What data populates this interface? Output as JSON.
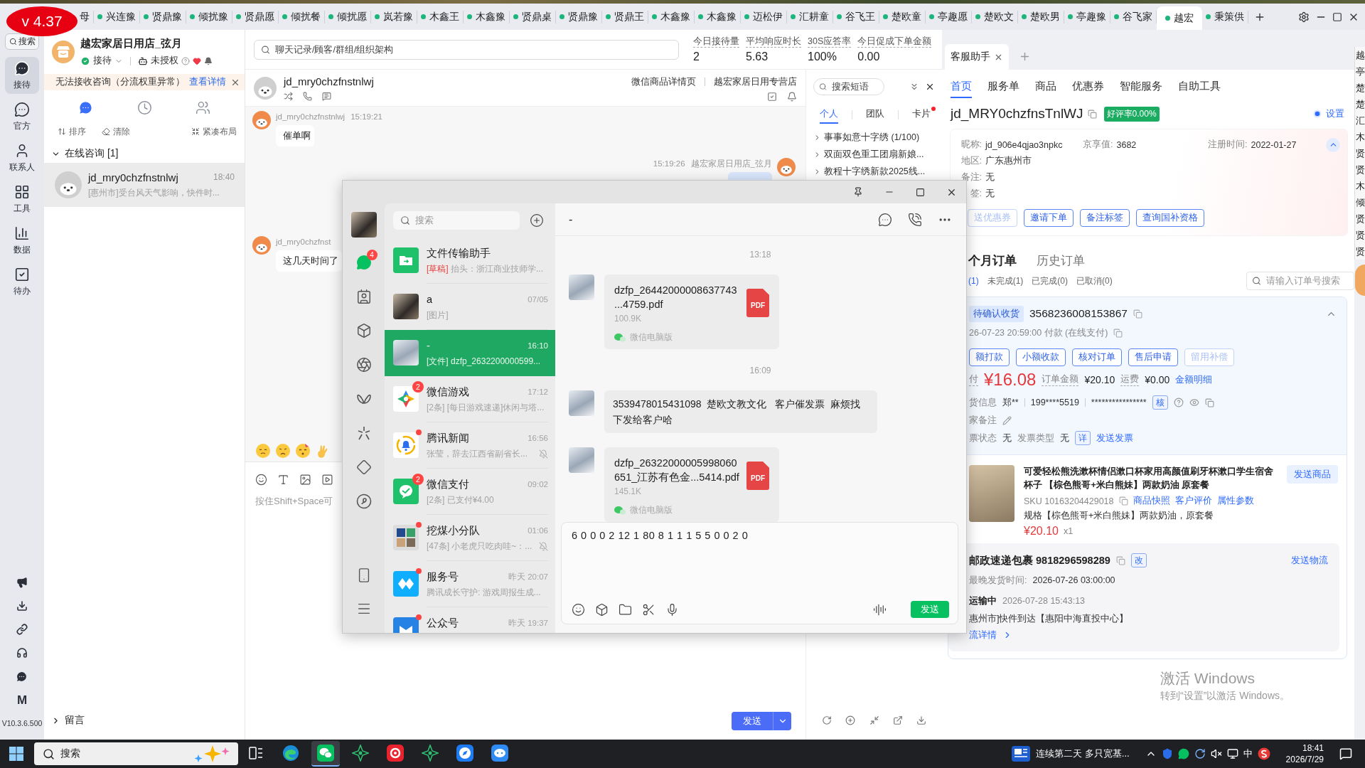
{
  "version_badge": "v 4.37",
  "shop_tabs": [
    {
      "label": "母",
      "selected": false
    },
    {
      "label": "兴连豫",
      "selected": false
    },
    {
      "label": "贤鼎豫",
      "selected": false
    },
    {
      "label": "倾扰豫",
      "selected": false
    },
    {
      "label": "贤鼎愿",
      "selected": false
    },
    {
      "label": "倾扰餐",
      "selected": false
    },
    {
      "label": "倾扰愿",
      "selected": false
    },
    {
      "label": "岚若豫",
      "selected": false
    },
    {
      "label": "木鑫王",
      "selected": false
    },
    {
      "label": "木鑫豫",
      "selected": false
    },
    {
      "label": "贤鼎桌",
      "selected": false
    },
    {
      "label": "贤鼎豫",
      "selected": false
    },
    {
      "label": "贤鼎王",
      "selected": false
    },
    {
      "label": "木鑫豫",
      "selected": false
    },
    {
      "label": "木鑫豫",
      "selected": false
    },
    {
      "label": "迈松伊",
      "selected": false
    },
    {
      "label": "汇耕童",
      "selected": false
    },
    {
      "label": "谷飞王",
      "selected": false
    },
    {
      "label": "楚欧童",
      "selected": false
    },
    {
      "label": "亭趣愿",
      "selected": false
    },
    {
      "label": "楚欧文",
      "selected": false
    },
    {
      "label": "楚欧男",
      "selected": false
    },
    {
      "label": "亭趣豫",
      "selected": false
    },
    {
      "label": "谷飞家",
      "selected": false
    },
    {
      "label": "越宏",
      "selected": true
    },
    {
      "label": "秉策供",
      "selected": false
    }
  ],
  "icon_rail": {
    "search": "搜索",
    "items": [
      {
        "label": "接待",
        "selected": true
      },
      {
        "label": "官方",
        "selected": false
      },
      {
        "label": "联系人",
        "selected": false
      },
      {
        "label": "工具",
        "selected": false
      },
      {
        "label": "数据",
        "selected": false
      },
      {
        "label": "待办",
        "selected": false
      }
    ],
    "logo_letter": "M",
    "version": "V10.3.6.500"
  },
  "conversations": {
    "shop_name": "越宏家居日用店_弦月",
    "status": "接待",
    "authorization": "未授权",
    "alert": {
      "text": "无法接收咨询（分流权重异常）",
      "link": "查看详情"
    },
    "view_tabs": [
      {
        "selected": true
      },
      {
        "selected": false
      },
      {
        "selected": false
      }
    ],
    "actions": [
      "排序",
      "清除",
      "紧凑布局"
    ],
    "groups": [
      {
        "title": "在线咨询 [1]",
        "expanded": true,
        "items": [
          {
            "name": "jd_mry0chzfnstnlwj",
            "time": "18:40",
            "preview": "[惠州市]受台风天气影响，快件时...",
            "selected": true
          }
        ]
      },
      {
        "title": "留言",
        "expanded": false
      }
    ]
  },
  "chat": {
    "search_placeholder": "聊天记录/顾客/群组/组织架构",
    "stats": [
      {
        "label": "今日接待量",
        "value": "2"
      },
      {
        "label": "平均响应时长",
        "value": "5.63"
      },
      {
        "label": "30S应答率",
        "value": "100%"
      },
      {
        "label": "今日促成下单金额",
        "value": "0.00"
      }
    ],
    "customer": "jd_mry0chzfnstnlwj",
    "source": "微信商品详情页",
    "store": "越宏家居日用专营店",
    "messages": [
      {
        "kind": "incoming",
        "sender": "jd_mry0chzfnstnlwj",
        "time": "15:19:21",
        "text": "催单啊"
      },
      {
        "kind": "outgoing",
        "time": "15:19:26",
        "sender": "越宏家居日用店_弦月"
      },
      {
        "kind": "incoming",
        "sender": "jd_mry0chzfnst",
        "text": "这几天时间了"
      }
    ],
    "composer_hint": "按住Shift+Space可",
    "send": "发送"
  },
  "phrases": {
    "placeholder": "搜索短语",
    "tabs": [
      {
        "label": "个人",
        "selected": true,
        "dot": false
      },
      {
        "label": "团队",
        "selected": false,
        "dot": false
      },
      {
        "label": "卡片",
        "selected": false,
        "dot": true
      }
    ],
    "groups": [
      "事事如意十字绣 (1/100)",
      "双面双色重工团扇新娘...",
      "教程十字绣新款2025线..."
    ]
  },
  "assistant": {
    "tabs": [
      {
        "label": "客服助手",
        "selected": true
      }
    ],
    "nav": [
      {
        "label": "首页",
        "selected": true
      },
      {
        "label": "服务单",
        "selected": false
      },
      {
        "label": "商品",
        "selected": false
      },
      {
        "label": "优惠券",
        "selected": false
      },
      {
        "label": "智能服务",
        "selected": false
      },
      {
        "label": "自助工具",
        "selected": false
      }
    ],
    "customer": {
      "id": "jd_MRY0chzfnsTnlWJ",
      "rating": "好评率0.00%",
      "settings": "设置",
      "expanded": true,
      "rows": [
        [
          {
            "label": "昵称:",
            "value": "jd_906e4qjao3npkc"
          },
          {
            "label": "京享值:",
            "value": "3682"
          },
          {
            "label": "注册时间:",
            "value": "2022-01-27"
          }
        ],
        [
          {
            "label": "地区:",
            "value": "广东惠州市"
          }
        ],
        [
          {
            "label": "备注:",
            "value": "无"
          }
        ],
        [
          {
            "label": "签:",
            "value": "无"
          }
        ]
      ],
      "actions": [
        {
          "label": "送优惠券",
          "disabled": true
        },
        {
          "label": "邀请下单",
          "disabled": false
        },
        {
          "label": "备注标签",
          "disabled": false
        },
        {
          "label": "查询国补资格",
          "disabled": false
        }
      ]
    },
    "orders": {
      "tabs": [
        {
          "label": "个月订单",
          "selected": true
        },
        {
          "label": "历史订单",
          "selected": false
        }
      ],
      "filters": [
        {
          "label": "(1)",
          "selected": true
        },
        {
          "label": "未完成(1)",
          "selected": false
        },
        {
          "label": "已完成(0)",
          "selected": false
        },
        {
          "label": "已取消(0)",
          "selected": false
        }
      ],
      "search_placeholder": "请输入订单号搜索",
      "order": {
        "status": "待确认收货",
        "number": "3568236008153867",
        "expanded": true,
        "paid": "26-07-23 20:59:00  付款  (在线支付)",
        "actions": [
          {
            "label": "额打款",
            "disabled": false
          },
          {
            "label": "小额收款",
            "disabled": false
          },
          {
            "label": "核对订单",
            "disabled": false
          },
          {
            "label": "售后申请",
            "disabled": false
          },
          {
            "label": "留用补偿",
            "disabled": true
          }
        ],
        "paid_label": "付",
        "paid_amount": "¥16.08",
        "total_label": "订单金额",
        "total": "¥20.10",
        "shipping_label": "运费",
        "shipping": "¥0.00",
        "breakdown_link": "金额明细",
        "receiver_label": "货信息",
        "receiver_name": "郑**",
        "receiver_phone": "199****5519",
        "receiver_address": "****************",
        "verify": "核",
        "note_label": "家备注",
        "invoice": [
          {
            "label": "票状态",
            "value": "无"
          },
          {
            "label": "发票类型",
            "value": "无"
          }
        ],
        "invoice_detail": "详",
        "invoice_link": "发送发票",
        "product": {
          "title": "可爱轻松熊洗漱杯情侣漱口杯家用高颜值刷牙杯漱口学生宿舍杯子 【棕色熊哥+米白熊妹】两款奶油 原套餐",
          "send": "发送商品",
          "sku": "SKU 10163204429018",
          "links": [
            "商品快照",
            "客户评价",
            "属性参数"
          ],
          "spec": "规格【棕色熊哥+米白熊妹】两款奶油，原套餐",
          "price": "¥20.10",
          "quantity": "x1"
        },
        "shipment": {
          "carrier": "邮政速递包裹 9818296598289",
          "edit": "改",
          "send": "发送物流",
          "deadline_label": "最晚发货时间:",
          "deadline": "2026-07-26 03:00:00",
          "status": "运输中",
          "status_time": "2026-07-28 15:43:13",
          "detail": "惠州市]快件到达【惠阳中海直投中心】",
          "link": "流详情"
        }
      }
    }
  },
  "windows_notice": {
    "title": "激活 Windows",
    "subtitle": "转到“设置”以激活 Windows。"
  },
  "edge_list": [
    "越",
    "亭",
    "楚",
    "楚",
    "汇",
    "木",
    "贤",
    "贤",
    "木",
    "倾",
    "贤",
    "贤",
    "贤"
  ],
  "wechat": {
    "nav": [
      {
        "selected": true,
        "badge": "4"
      },
      {
        "selected": false
      },
      {
        "selected": false
      },
      {
        "selected": false
      },
      {
        "selected": false
      },
      {
        "selected": false
      },
      {
        "selected": false
      },
      {
        "selected": false
      }
    ],
    "search_placeholder": "搜索",
    "chats": [
      {
        "kind": "transfer",
        "name": "文件传输助手",
        "draft": "[草稿]",
        "preview": "抬头：浙江商业技师学...",
        "selected": false
      },
      {
        "kind": "photo",
        "name": "a",
        "time": "07/05",
        "preview": "[图片]",
        "selected": false
      },
      {
        "kind": "character",
        "name": "-",
        "time": "16:10",
        "preview": "[文件] dzfp_2632200000599...",
        "selected": true
      },
      {
        "kind": "games",
        "name": "微信游戏",
        "time": "17:12",
        "preview": "[2条] [每日游戏速递]休闲与塔...",
        "badge": "2",
        "selected": false
      },
      {
        "kind": "news",
        "name": "腾讯新闻",
        "time": "16:56",
        "preview": "张莹，辞去江西省副省长...",
        "dot": true,
        "muted": true,
        "selected": false
      },
      {
        "kind": "pay",
        "name": "微信支付",
        "time": "09:02",
        "preview": "[2条] 已支付¥4.00",
        "badge": "2",
        "selected": false
      },
      {
        "kind": "group",
        "name": "挖煤小分队",
        "time": "01:06",
        "preview": "[47条] 小老虎只吃肉哇~：...",
        "dot": true,
        "muted": true,
        "selected": false
      },
      {
        "kind": "service",
        "name": "服务号",
        "time": "昨天 20:07",
        "preview": "腾讯成长守护: 游戏周报生成...",
        "dot": true,
        "selected": false
      },
      {
        "kind": "subscription",
        "name": "公众号",
        "time": "昨天 19:37",
        "dot": true,
        "selected": false
      }
    ],
    "chat_title": "-",
    "messages": [
      {
        "kind": "time",
        "text": "13:18"
      },
      {
        "kind": "file",
        "lines": [
          "dzfp_26442000008637743",
          "...4759.pdf"
        ],
        "size": "100.9K",
        "file_type": "PDF",
        "source": "微信电脑版"
      },
      {
        "kind": "time",
        "text": "16:09"
      },
      {
        "kind": "text",
        "text": "3539478015431098  楚欧文教文化   客户催发票  麻烦找下发给客户哈"
      },
      {
        "kind": "file",
        "lines": [
          "dzfp_26322000005998060",
          "651_江苏有色金...5414.pdf"
        ],
        "size": "145.1K",
        "file_type": "PDF",
        "source": "微信电脑版"
      }
    ],
    "draft": "6 0 0 0 2 12 1 80 8 1 1 1 5 5 0 0 2 0",
    "send": "发送"
  },
  "taskbar": {
    "search": "搜索",
    "apps": [
      {
        "selected": false
      },
      {
        "selected": false
      },
      {
        "selected": true
      },
      {
        "selected": false
      },
      {
        "selected": false
      },
      {
        "selected": false
      },
      {
        "selected": false
      },
      {
        "selected": false
      }
    ],
    "news": "连续第二天 多只宽基...",
    "ime": "中",
    "time": "18:41",
    "date": "2026/7/29"
  }
}
